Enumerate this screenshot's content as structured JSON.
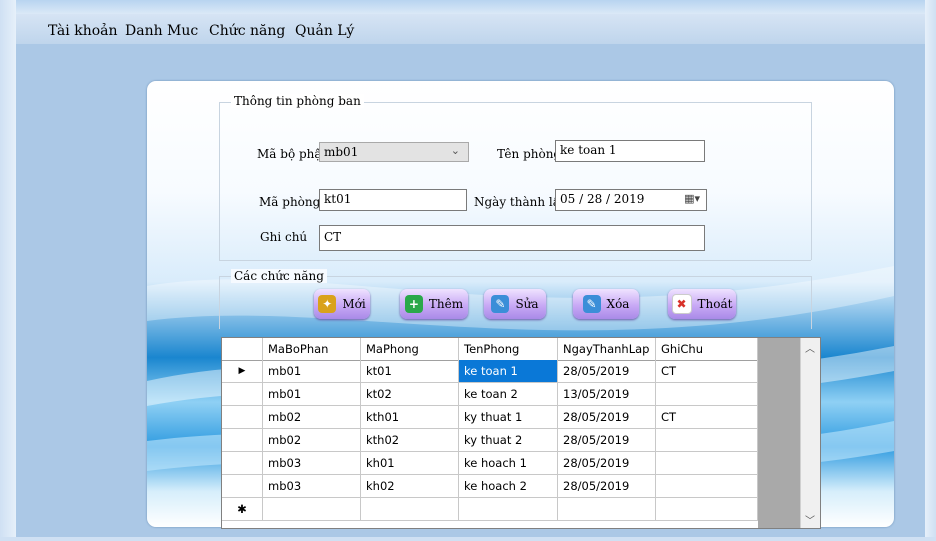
{
  "menu": [
    "Tài khoản",
    "Danh Muc",
    "Chức năng",
    "Quản Lý"
  ],
  "info_group": {
    "title": "Thông tin phòng ban",
    "ma_bo_phan_label": "Mã bộ phận",
    "ma_bo_phan_value": "mb01",
    "ten_phong_label": "Tên phòng",
    "ten_phong_value": "ke toan 1",
    "ma_phong_label": "Mã phòng",
    "ma_phong_value": "kt01",
    "ngay_thanh_lap_label": "Ngày thành lập",
    "ngay_thanh_lap_value": "05 / 28 / 2019",
    "ghi_chu_label": "Ghi chú",
    "ghi_chu_value": "CT"
  },
  "actions_group": {
    "title": "Các chức năng",
    "buttons": [
      {
        "label": "Mới",
        "icon": "new-icon",
        "color": "#d9a21b"
      },
      {
        "label": "Thêm",
        "icon": "add-icon",
        "color": "#2aa84a"
      },
      {
        "label": "Sửa",
        "icon": "edit-icon",
        "color": "#3b8ed8"
      },
      {
        "label": "Xóa",
        "icon": "delete-icon",
        "color": "#3b8ed8"
      },
      {
        "label": "Thoát",
        "icon": "exit-icon",
        "color": "#d8322a"
      }
    ]
  },
  "grid": {
    "columns": [
      "MaBoPhan",
      "MaPhong",
      "TenPhong",
      "NgayThanhLap",
      "GhiChu"
    ],
    "rows": [
      [
        "mb01",
        "kt01",
        "ke toan 1",
        "28/05/2019",
        "CT"
      ],
      [
        "mb01",
        "kt02",
        "ke toan 2",
        "13/05/2019",
        ""
      ],
      [
        "mb02",
        "kth01",
        "ky thuat 1",
        "28/05/2019",
        "CT"
      ],
      [
        "mb02",
        "kth02",
        "ky thuat 2",
        "28/05/2019",
        ""
      ],
      [
        "mb03",
        "kh01",
        "ke hoach 1",
        "28/05/2019",
        ""
      ],
      [
        "mb03",
        "kh02",
        "ke hoach 2",
        "28/05/2019",
        ""
      ]
    ],
    "current_row_marker": "▶",
    "new_row_marker": "✱",
    "selected_cell": "ke toan 1",
    "selection_color": "#0a78d7"
  }
}
